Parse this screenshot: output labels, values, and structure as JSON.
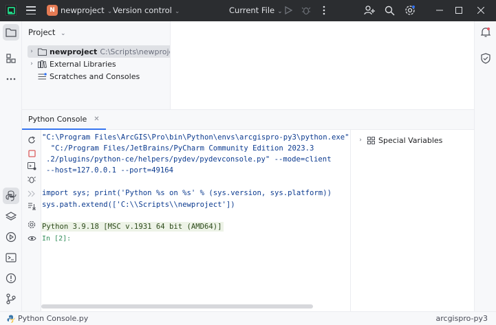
{
  "titlebar": {
    "project_badge": "N",
    "project_name": "newproject",
    "vcs_label": "Version control",
    "run_config": "Current File"
  },
  "project_panel": {
    "title": "Project",
    "tree": [
      {
        "label": "newproject",
        "path": "C:\\Scripts\\newproject"
      },
      {
        "label": "External Libraries"
      },
      {
        "label": "Scratches and Consoles"
      }
    ]
  },
  "console": {
    "tab_label": "Python Console",
    "lines": [
      "\"C:\\Program Files\\ArcGIS\\Pro\\bin\\Python\\envs\\arcgispro-py3\\python.exe\"",
      "  \"C:/Program Files/JetBrains/PyCharm Community Edition 2023.3",
      ".2/plugins/python-ce/helpers/pydev/pydevconsole.py\" --mode=client",
      "--host=127.0.0.1 --port=49164",
      "import sys; print('Python %s on %s' % (sys.version, sys.platform))",
      "sys.path.extend(['C:\\\\Scripts\\\\newproject'])"
    ],
    "banner": "Python 3.9.18 [MSC v.1931 64 bit (AMD64)]",
    "prompt": "In [2]:"
  },
  "variables_panel": {
    "label": "Special Variables"
  },
  "statusbar": {
    "left_label": "Python Console.py",
    "interpreter": "arcgispro-py3"
  },
  "colors": {
    "titlebar_bg": "#2b2d30",
    "accent": "#3574f0",
    "project_badge": "#e57b54",
    "console_text": "#0b3a8f",
    "banner_bg": "#edf3e7"
  }
}
